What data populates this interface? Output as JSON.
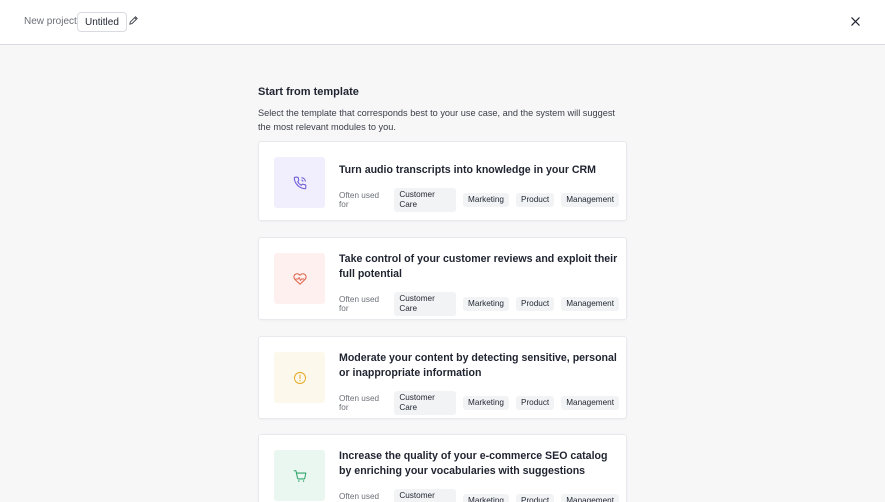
{
  "header": {
    "new_project_label": "New project",
    "project_name": "Untitled"
  },
  "main": {
    "heading": "Start from template",
    "description": "Select the template that corresponds best to your use case, and the system will suggest the most relevant modules to you."
  },
  "templates": [
    {
      "title": "Turn audio transcripts into knowledge in your CRM",
      "icon": "phone-icon",
      "icon_bg": "#f1effd",
      "icon_color": "#6a58d6",
      "often_used_label": "Often used for",
      "tags": [
        "Customer Care",
        "Marketing",
        "Product",
        "Management"
      ]
    },
    {
      "title": "Take control of your customer reviews and exploit their full potential",
      "icon": "heart-pulse-icon",
      "icon_bg": "#fdf0ee",
      "icon_color": "#e0634a",
      "often_used_label": "Often used for",
      "tags": [
        "Customer Care",
        "Marketing",
        "Product",
        "Management"
      ]
    },
    {
      "title": "Moderate your content by detecting sensitive, personal or inappropriate information",
      "icon": "alert-circle-icon",
      "icon_bg": "#fdf8ec",
      "icon_color": "#e3ad2c",
      "often_used_label": "Often used for",
      "tags": [
        "Customer Care",
        "Marketing",
        "Product",
        "Management"
      ]
    },
    {
      "title": "Increase the quality of your e-commerce SEO catalog by enriching your vocabularies with suggestions",
      "icon": "cart-icon",
      "icon_bg": "#eaf7f0",
      "icon_color": "#2fa56a",
      "often_used_label": "Often used for",
      "tags": [
        "Customer Care",
        "Marketing",
        "Product",
        "Management"
      ]
    }
  ]
}
